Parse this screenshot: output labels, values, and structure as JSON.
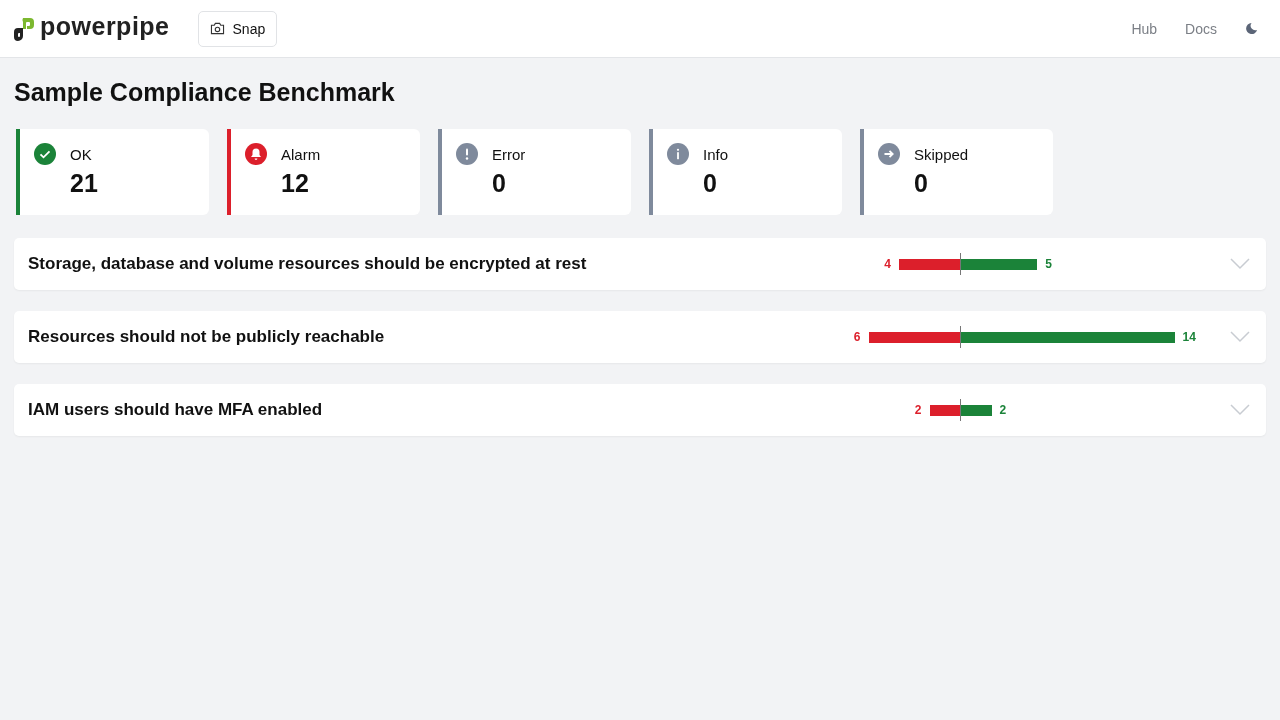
{
  "header": {
    "brand": "powerpipe",
    "snap_button": "Snap",
    "links": [
      "Hub",
      "Docs"
    ]
  },
  "title": "Sample Compliance Benchmark",
  "summary": [
    {
      "kind": "ok",
      "label": "OK",
      "count": "21"
    },
    {
      "kind": "alarm",
      "label": "Alarm",
      "count": "12"
    },
    {
      "kind": "error",
      "label": "Error",
      "count": "0"
    },
    {
      "kind": "info",
      "label": "Info",
      "count": "0"
    },
    {
      "kind": "skipped",
      "label": "Skipped",
      "count": "0"
    }
  ],
  "controls": [
    {
      "title": "Storage, database and volume resources should be encrypted at rest",
      "alarm_count": "4",
      "ok_count": "5",
      "expanded": false
    },
    {
      "title": "Resources should not be publicly reachable",
      "alarm_count": "6",
      "ok_count": "14",
      "expanded": false
    },
    {
      "title": "IAM users should have MFA enabled",
      "alarm_count": "2",
      "ok_count": "2",
      "expanded": false
    }
  ]
}
